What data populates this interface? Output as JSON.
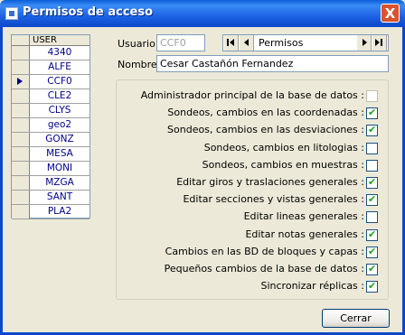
{
  "window": {
    "title": "Permisos de acceso",
    "close_glyph": "X"
  },
  "grid": {
    "header": "USER",
    "selected_index": 2,
    "rows": [
      "4340",
      "ALFE",
      "CCF0",
      "CLE2",
      "CLYS",
      "geo2",
      "GONZ",
      "MESA",
      "MONI",
      "MZGA",
      "SANT",
      "PLA2"
    ]
  },
  "form": {
    "usuario_label": "Usuario :",
    "usuario_value": "CCF0",
    "nombre_label": "Nombre :",
    "nombre_value": "Cesar Castañón Fernandez",
    "navigator_caption": "Permisos"
  },
  "permissions": [
    {
      "label": "Administrador principal de la base de datos :",
      "checked": false,
      "enabled": false
    },
    {
      "label": "Sondeos, cambios en las coordenadas :",
      "checked": true,
      "enabled": true
    },
    {
      "label": "Sondeos, cambios en las desviaciones :",
      "checked": true,
      "enabled": true
    },
    {
      "label": "Sondeos, cambios en litologias :",
      "checked": false,
      "enabled": true
    },
    {
      "label": "Sondeos, cambios en muestras :",
      "checked": false,
      "enabled": true
    },
    {
      "label": "Editar giros y traslaciones generales :",
      "checked": true,
      "enabled": true
    },
    {
      "label": "Editar secciones y vistas generales :",
      "checked": true,
      "enabled": true
    },
    {
      "label": "Editar lineas generales :",
      "checked": false,
      "enabled": true
    },
    {
      "label": "Editar notas generales :",
      "checked": true,
      "enabled": true
    },
    {
      "label": "Cambios en las BD de bloques y capas :",
      "checked": true,
      "enabled": true
    },
    {
      "label": "Pequeños cambios de la base de datos :",
      "checked": true,
      "enabled": true
    },
    {
      "label": "Sincronizar réplicas :",
      "checked": true,
      "enabled": true
    }
  ],
  "buttons": {
    "close_label": "Cerrar"
  },
  "colors": {
    "titlebar": "#1D62E4",
    "check_mark": "#21A121",
    "window_bg": "#ECE9D8"
  }
}
